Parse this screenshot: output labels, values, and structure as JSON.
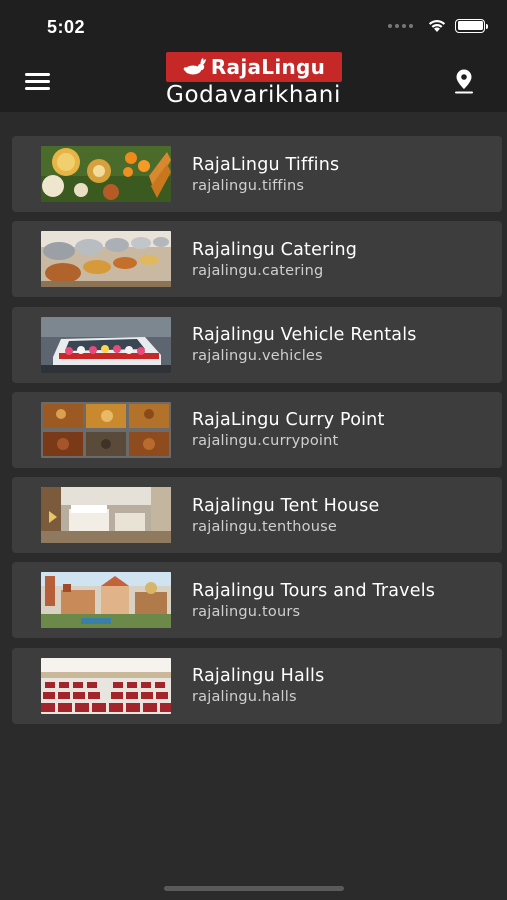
{
  "status": {
    "time": "5:02"
  },
  "header": {
    "logo_text": "RajaLingu",
    "city": "Godavarikhani",
    "menu_icon": "hamburger-menu-icon",
    "location_icon": "map-pin-icon"
  },
  "colors": {
    "background": "#2b2b2b",
    "header": "#1f1f1f",
    "card": "#3d3d3d",
    "brand_red": "#c62828"
  },
  "services": [
    {
      "title": "RajaLingu Tiffins",
      "subtitle": "rajalingu.tiffins"
    },
    {
      "title": "Rajalingu Catering",
      "subtitle": "rajalingu.catering"
    },
    {
      "title": "Rajalingu Vehicle Rentals",
      "subtitle": "rajalingu.vehicles"
    },
    {
      "title": "RajaLingu Curry Point",
      "subtitle": "rajalingu.currypoint"
    },
    {
      "title": "Rajalingu Tent House",
      "subtitle": "rajalingu.tenthouse"
    },
    {
      "title": "Rajalingu Tours and Travels",
      "subtitle": "rajalingu.tours"
    },
    {
      "title": "Rajalingu Halls",
      "subtitle": "rajalingu.halls"
    }
  ]
}
